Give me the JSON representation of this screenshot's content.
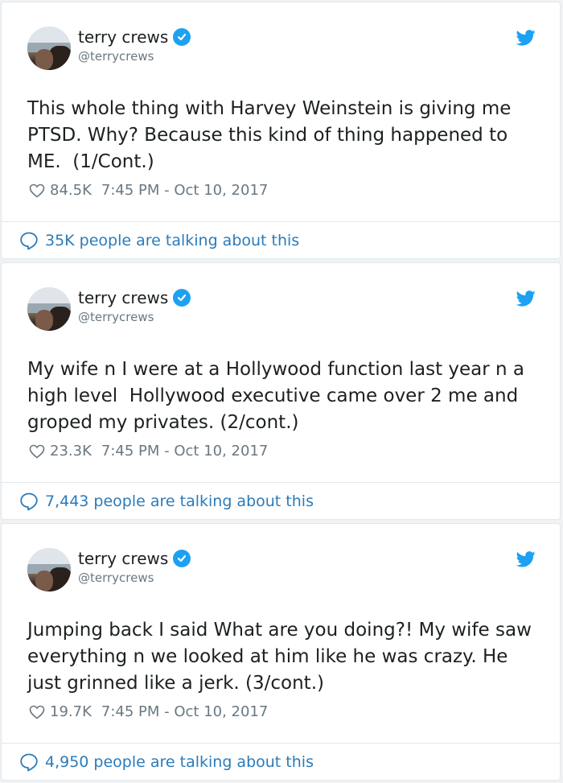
{
  "colors": {
    "accent": "#1da1f2",
    "link": "#2b7bb9",
    "muted": "#697882",
    "text": "#1c2022"
  },
  "tweets": [
    {
      "name": "terry crews",
      "handle": "@terrycrews",
      "text": "This whole thing with Harvey Weinstein is giving me PTSD. Why? Because this kind of thing happened to ME.  (1/Cont.)",
      "likes": "84.5K",
      "timestamp": "7:45 PM - Oct 10, 2017",
      "talking": "35K people are talking about this"
    },
    {
      "name": "terry crews",
      "handle": "@terrycrews",
      "text": "My wife n I were at a Hollywood function last year n a high level  Hollywood executive came over 2 me and groped my privates. (2/cont.)",
      "likes": "23.3K",
      "timestamp": "7:45 PM - Oct 10, 2017",
      "talking": "7,443 people are talking about this"
    },
    {
      "name": "terry crews",
      "handle": "@terrycrews",
      "text": "Jumping back I said What are you doing?! My wife saw everything n we looked at him like he was crazy. He just grinned like a jerk. (3/cont.)",
      "likes": "19.7K",
      "timestamp": "7:45 PM - Oct 10, 2017",
      "talking": "4,950 people are talking about this"
    }
  ],
  "icons": [
    "verified-badge-icon",
    "twitter-bird-icon",
    "heart-icon",
    "speech-bubble-icon"
  ]
}
